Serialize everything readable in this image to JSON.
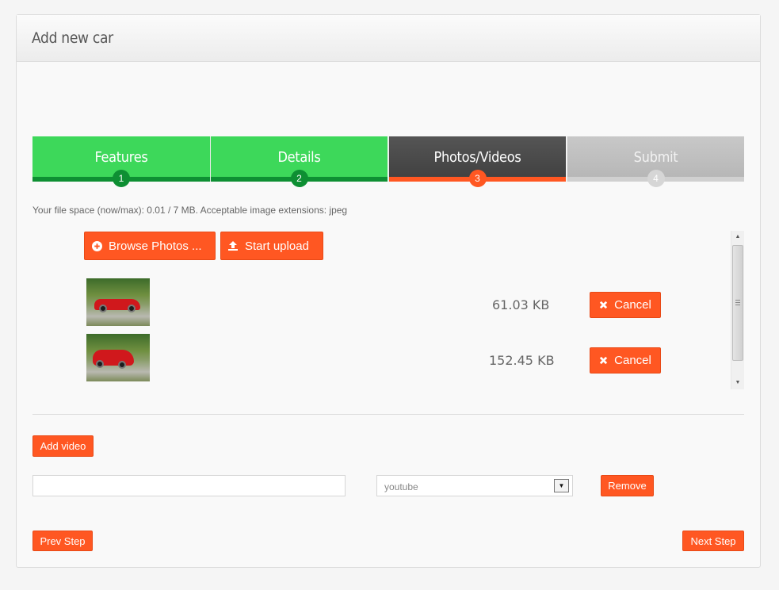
{
  "panel": {
    "title": "Add new car"
  },
  "steps": [
    {
      "label": "Features",
      "number": "1",
      "state": "done"
    },
    {
      "label": "Details",
      "number": "2",
      "state": "done"
    },
    {
      "label": "Photos/Videos",
      "number": "3",
      "state": "active"
    },
    {
      "label": "Submit",
      "number": "4",
      "state": "todo"
    }
  ],
  "upload": {
    "file_space": "Your file space (now/max): 0.01 / 7 MB.  Acceptable image extensions: jpeg",
    "browse_label": "Browse Photos ...",
    "start_label": "Start upload",
    "files": [
      {
        "size": "61.03 KB",
        "cancel_label": "Cancel"
      },
      {
        "size": "152.45 KB",
        "cancel_label": "Cancel"
      }
    ]
  },
  "video": {
    "add_label": "Add video",
    "url_value": "",
    "source_selected": "youtube",
    "remove_label": "Remove"
  },
  "nav": {
    "prev_label": "Prev Step",
    "next_label": "Next Step"
  },
  "colors": {
    "accent": "#ff5722",
    "done": "#3dd85a",
    "done_dark": "#0e8f33",
    "active": "#444444"
  },
  "icons": {
    "browse": "plus-circle-icon",
    "upload": "upload-icon",
    "cancel": "close-icon",
    "select": "caret-down-icon"
  }
}
